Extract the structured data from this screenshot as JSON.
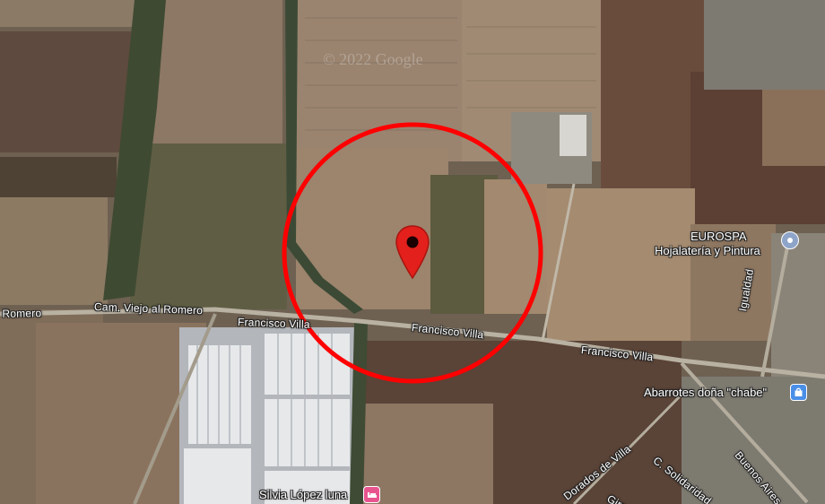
{
  "watermark": "© 2022 Google",
  "colors": {
    "highlight_circle": "#ff0000",
    "marker": "#e3201b",
    "poi_pin": "#8ea4c9",
    "lodging_pin": "#e8558e"
  },
  "marker": {
    "icon": "map-marker-icon"
  },
  "roads": {
    "romero_left": "l Romero",
    "cam_viejo": "Cam. Viejo al Romero",
    "francisco_villa_1": "Francisco Villa",
    "francisco_villa_2": "Francisco Villa",
    "francisco_villa_3": "Francisco Villa",
    "igualdad": "Igualdad",
    "dorados": "Dorados de Villa",
    "solidaridad": "C. Solidaridad",
    "buenos_aires": "Buenos Aires",
    "giras": "Giras"
  },
  "places": {
    "eurospa": {
      "label": "EUROSPA",
      "sublabel": "Hojalatería y Pintura",
      "icon": "location-pin-icon"
    },
    "abarrotes": {
      "label": "Abarrotes doña \"chabe\"",
      "icon": "shopping-bag-icon"
    },
    "silvia": {
      "label": "Silvia López luna",
      "icon": "bed-icon"
    }
  }
}
